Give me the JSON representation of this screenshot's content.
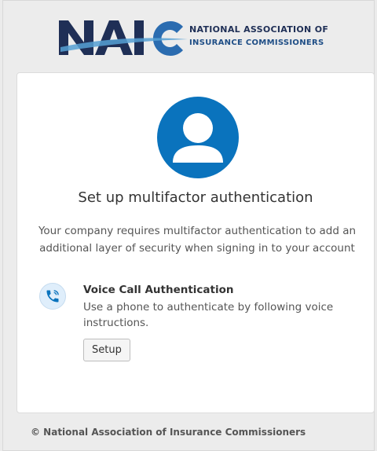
{
  "logo": {
    "acronym": "NAIC",
    "line1": "NATIONAL ASSOCIATION OF",
    "line2": "INSURANCE COMMISSIONERS",
    "colors": {
      "navy": "#1f2f56",
      "blue": "#2b6cb0",
      "light_blue": "#56a0d3"
    }
  },
  "setup": {
    "title": "Set up multifactor authentication",
    "description": "Your company requires multifactor authentication to add an additional layer of security when signing in to your account"
  },
  "factor": {
    "icon": "phone-call-icon",
    "title": "Voice Call Authentication",
    "description": "Use a phone to authenticate by following voice instructions.",
    "button_label": "Setup"
  },
  "footer": {
    "copyright": "© National Association of Insurance Commissioners"
  },
  "colors": {
    "avatar_blue": "#0a73bd",
    "page_bg": "#ececec",
    "card_bg": "#ffffff"
  }
}
